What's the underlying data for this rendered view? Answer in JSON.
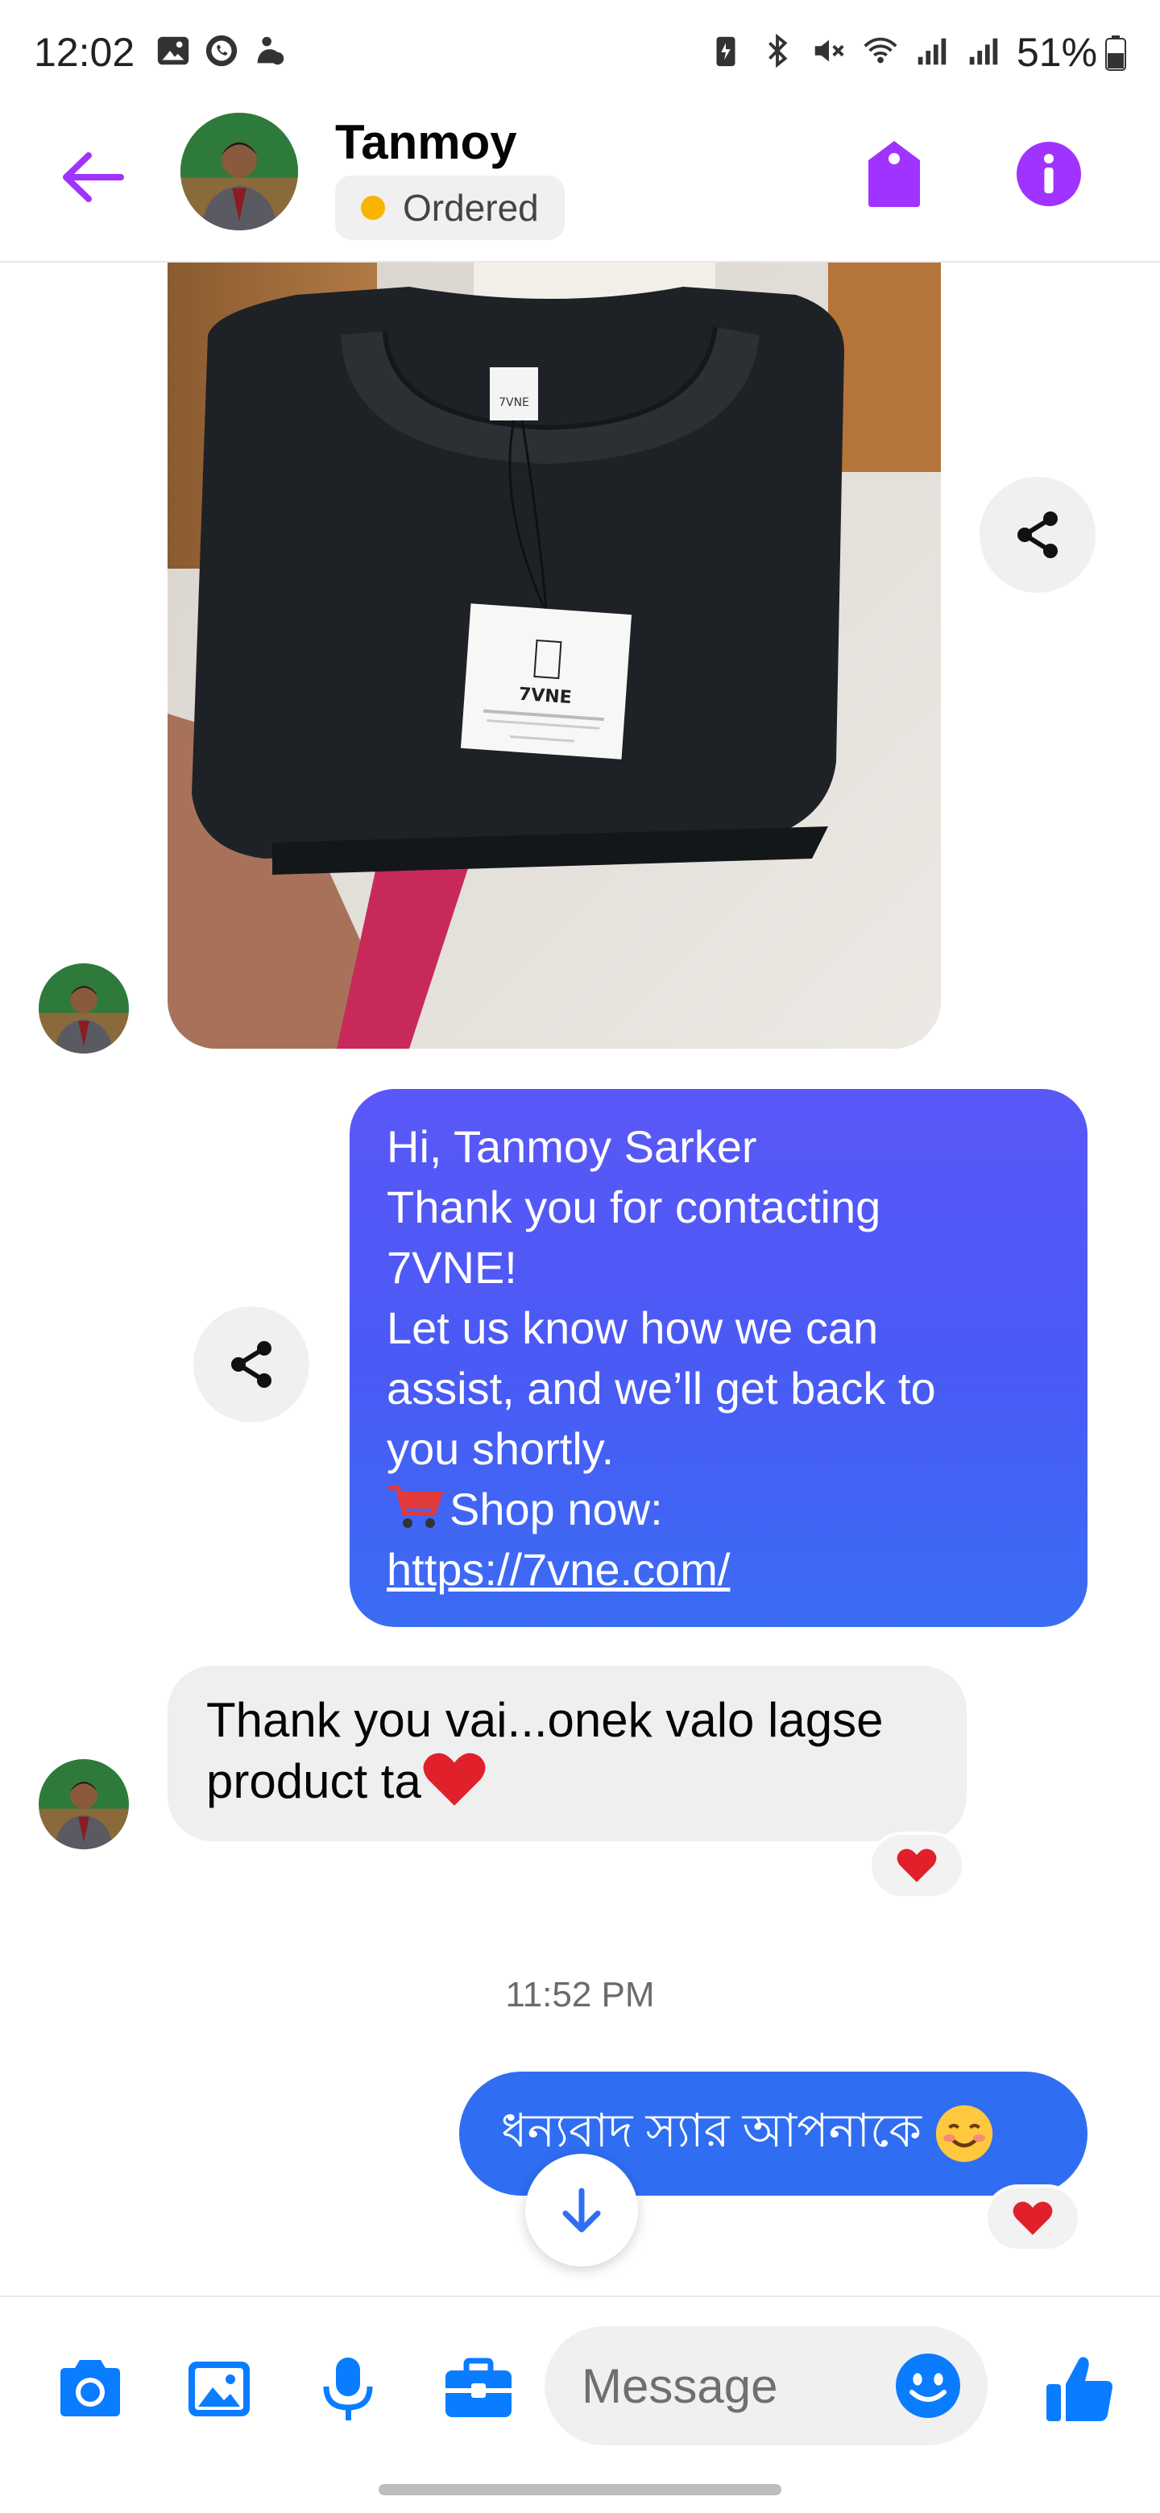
{
  "status_bar": {
    "time": "12:02",
    "battery_percent": "51%"
  },
  "header": {
    "contact_name": "Tanmoy",
    "status_label": "Ordered",
    "status_color": "#f7b500",
    "accent_color": "#a033ff"
  },
  "messages": {
    "greeting": {
      "line1": "Hi, Tanmoy Sarker",
      "line2": "Thank you for contacting",
      "line3": "7VNE!",
      "line4": "Let us know how we can",
      "line5": "assist, and we’ll get back to",
      "line6": "you shortly.",
      "line7": "Shop now:",
      "link": "https://7vne.com/"
    },
    "reply_customer": {
      "line1": "Thank you vai...onek valo lagse",
      "line2": "product ta"
    },
    "timestamp": "11:52 PM",
    "reply_shop": "ধন্যবাদ স্যার আপনাকে"
  },
  "photo": {
    "brand_tag": "7VNE"
  },
  "composer": {
    "placeholder": "Message",
    "icon_color": "#0a7cff"
  }
}
